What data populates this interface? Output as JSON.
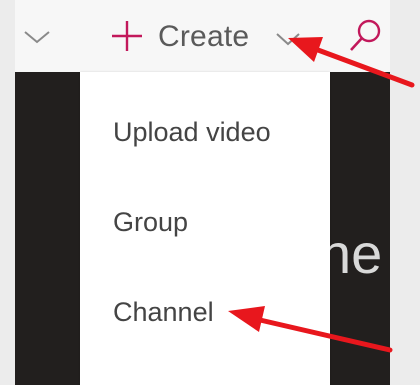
{
  "toolbar": {
    "create_label": "Create",
    "icons": {
      "expand": "chevron-down-icon",
      "create": "plus-icon",
      "create_dropdown": "chevron-down-icon",
      "search": "search-icon"
    },
    "accent_color": "#c2185b"
  },
  "create_menu": {
    "items": [
      {
        "label": "Upload video"
      },
      {
        "label": "Group"
      },
      {
        "label": "Channel"
      }
    ]
  },
  "background": {
    "partial_heading": "ne"
  },
  "annotations": {
    "arrow_color": "#e8171d",
    "arrow_targets": [
      "create-chevron-icon",
      "menu-item-channel"
    ]
  }
}
